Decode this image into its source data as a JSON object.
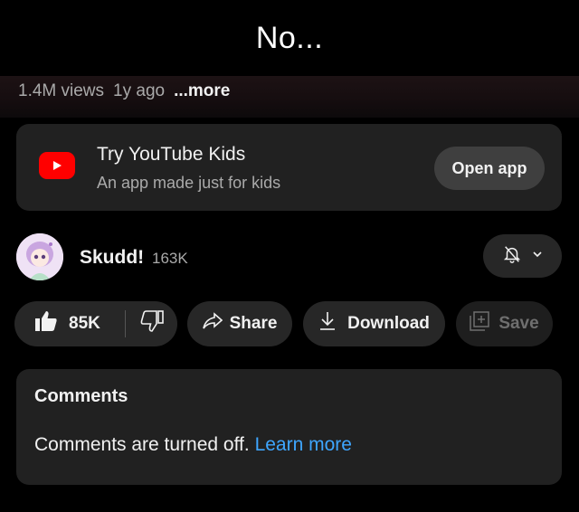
{
  "caption": "No...",
  "video_meta": {
    "views": "1.4M views",
    "age": "1y ago",
    "more": "...more"
  },
  "kids_promo": {
    "title": "Try YouTube Kids",
    "subtitle": "An app made just for kids",
    "button": "Open app",
    "icon": "youtube-kids-logo-icon"
  },
  "channel": {
    "name": "Skudd!",
    "subscribers": "163K",
    "notification_icon": "bell-off-icon"
  },
  "actions": {
    "likes": "85K",
    "share": "Share",
    "download": "Download",
    "save": "Save"
  },
  "comments": {
    "title": "Comments",
    "message": "Comments are turned off.",
    "link": "Learn more"
  },
  "colors": {
    "background": "#000000",
    "card": "#212121",
    "pill": "#272727",
    "link": "#3ea6ff",
    "brand_red": "#ff0000"
  }
}
